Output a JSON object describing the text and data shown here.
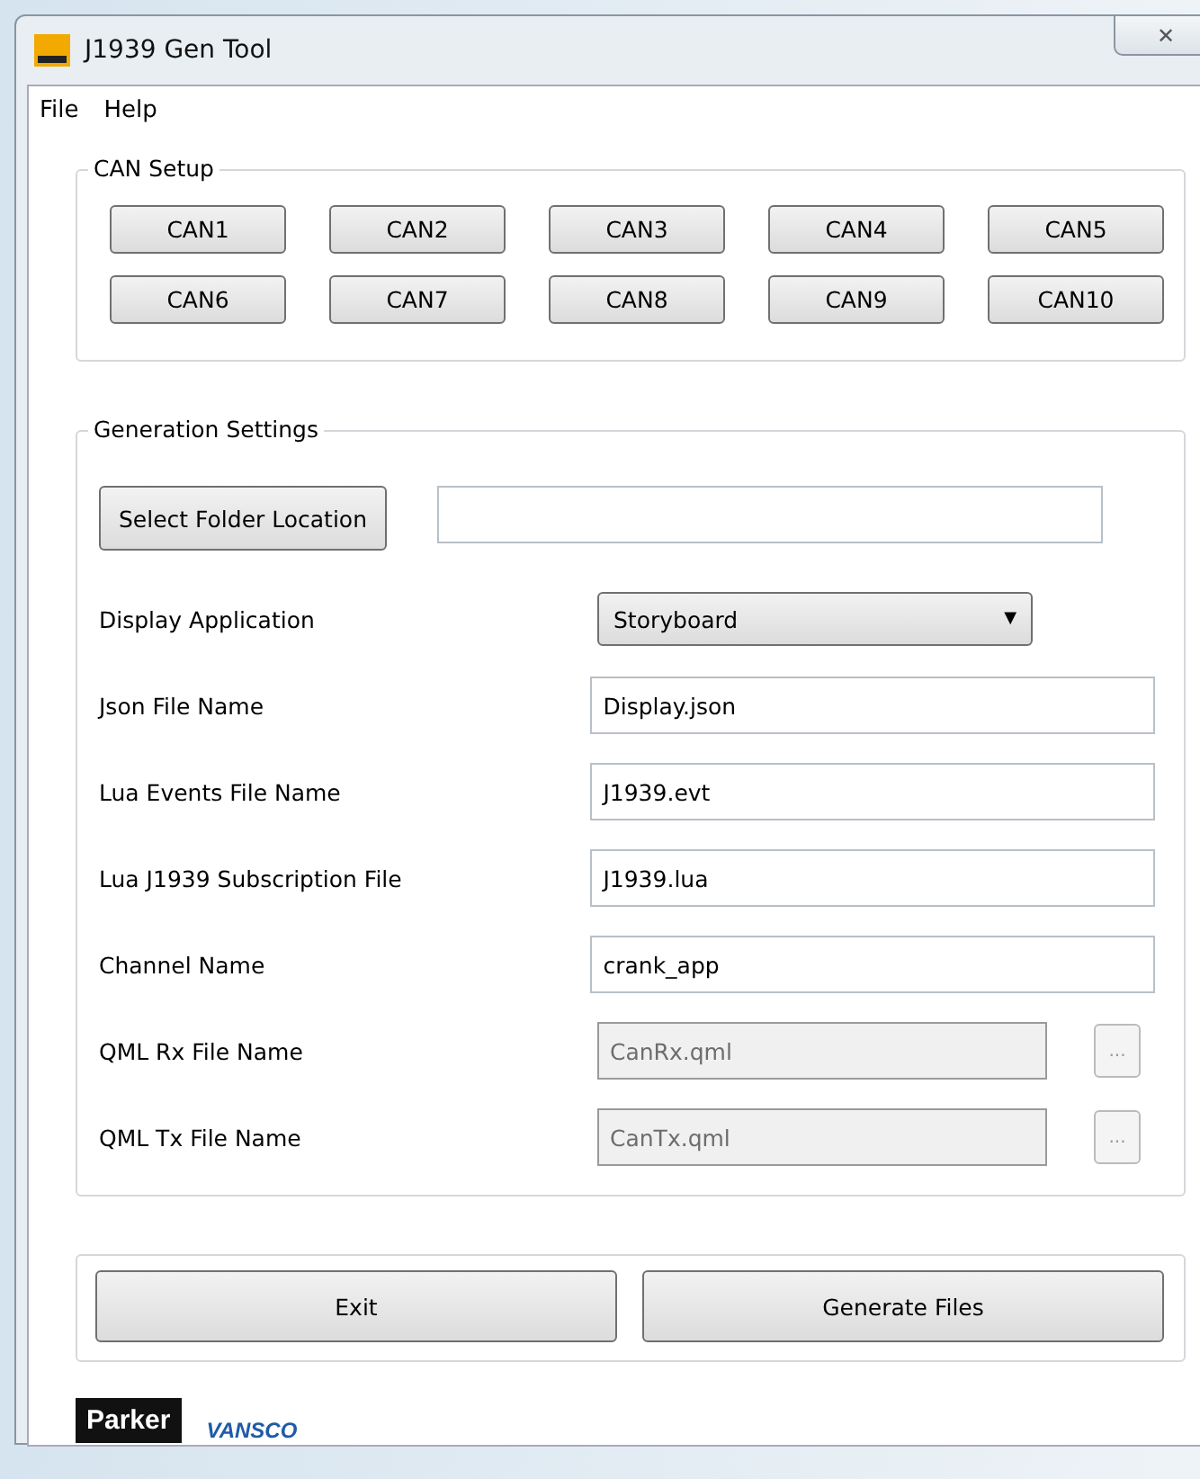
{
  "window": {
    "title": "J1939 Gen Tool",
    "close": "✕"
  },
  "menu": [
    "File",
    "Help"
  ],
  "can_setup": {
    "title": "CAN Setup",
    "buttons": [
      "CAN1",
      "CAN2",
      "CAN3",
      "CAN4",
      "CAN5",
      "CAN6",
      "CAN7",
      "CAN8",
      "CAN9",
      "CAN10"
    ]
  },
  "generation": {
    "title": "Generation Settings",
    "folder_button": "Select Folder Location",
    "fields": [
      {
        "kind": "dropdown",
        "label": "Display Application",
        "value": "Storyboard",
        "arrow": "▼"
      },
      {
        "kind": "text",
        "label": "Json File Name",
        "value": "Display.json",
        "disabled": false
      },
      {
        "kind": "text",
        "label": "Lua Events File Name",
        "value": "J1939.evt",
        "disabled": false
      },
      {
        "kind": "text",
        "label": "Lua J1939 Subscription File",
        "value": "J1939.lua",
        "disabled": false
      },
      {
        "kind": "text",
        "label": "Channel Name",
        "value": "crank_app",
        "disabled": false
      },
      {
        "kind": "browse",
        "label": "QML Rx File Name",
        "value": "CanRx.qml",
        "disabled": true,
        "button": "..."
      },
      {
        "kind": "browse",
        "label": "QML Tx File Name",
        "value": "CanTx.qml",
        "disabled": true,
        "button": "..."
      }
    ]
  },
  "actions": [
    "Exit",
    "Generate Files"
  ],
  "logos": [
    "Parker",
    "VANSCO"
  ]
}
